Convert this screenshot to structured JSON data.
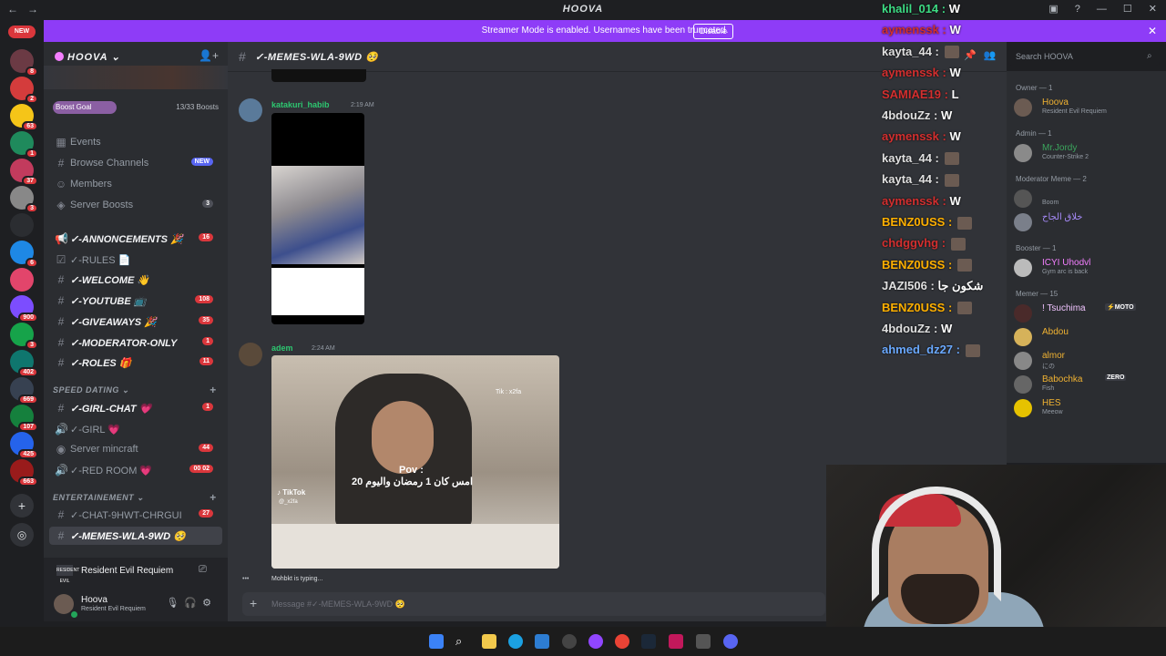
{
  "titlebar": {
    "app_title": "HOOVA",
    "back": "←",
    "forward": "→"
  },
  "banner": {
    "text": "Streamer Mode is enabled. Usernames have been truncated.",
    "disable_label": "Disable"
  },
  "rail": {
    "new_label": "NEW",
    "servers": [
      {
        "color": "#6b3a44",
        "badge": "8"
      },
      {
        "color": "#d43c3c",
        "badge": "2"
      },
      {
        "color": "#f5c518",
        "badge": "63"
      },
      {
        "color": "#1f8a5c",
        "badge": "1"
      },
      {
        "color": "#c23b5d",
        "badge": "37"
      },
      {
        "color": "#888888",
        "badge": "3"
      },
      {
        "color": "#2b2d31",
        "badge": ""
      },
      {
        "color": "#1e88e5",
        "badge": "6"
      },
      {
        "color": "#e2456b",
        "badge": ""
      },
      {
        "color": "#7c4dff",
        "badge": "900"
      },
      {
        "color": "#16a34a",
        "badge": "3"
      },
      {
        "color": "#0f766e",
        "badge": "402"
      },
      {
        "color": "#374151",
        "badge": "669"
      },
      {
        "color": "#15803d",
        "badge": "107"
      },
      {
        "color": "#2563eb",
        "badge": "425"
      },
      {
        "color": "#991b1b",
        "badge": "663"
      }
    ]
  },
  "sidebar": {
    "server_name": "HOOVA",
    "boost_goal": "Boost Goal",
    "boost_count": "13/33 Boosts",
    "top_items": [
      {
        "icon": "▦",
        "label": "Events",
        "badge": "",
        "badge_kind": ""
      },
      {
        "icon": "#",
        "label": "Browse Channels",
        "badge": "NEW",
        "badge_kind": "blue"
      },
      {
        "icon": "☺",
        "label": "Members",
        "badge": "",
        "badge_kind": ""
      },
      {
        "icon": "◈",
        "label": "Server Boosts",
        "badge": "3",
        "badge_kind": "gray"
      }
    ],
    "channels": [
      {
        "icon": "📢",
        "label": "✓-ANNONCEMENTS 🎉",
        "badge": "16",
        "bold": true
      },
      {
        "icon": "☑",
        "label": "✓-RULES 📄",
        "badge": "",
        "bold": false
      },
      {
        "icon": "#",
        "label": "✓-WELCOME 👋",
        "badge": "",
        "bold": true
      },
      {
        "icon": "#",
        "label": "✓-YOUTUBE 📺",
        "badge": "108",
        "bold": true
      },
      {
        "icon": "#",
        "label": "✓-GIVEAWAYS 🎉",
        "badge": "35",
        "bold": true
      },
      {
        "icon": "#",
        "label": "✓-MODERATOR-ONLY",
        "badge": "1",
        "bold": true
      },
      {
        "icon": "#",
        "label": "✓-ROLES 🎁",
        "badge": "11",
        "bold": true
      }
    ],
    "category1": "SPEED DATING ⌄",
    "speed_channels": [
      {
        "icon": "#",
        "label": "✓-GIRL-CHAT 💗",
        "badge": "1",
        "bold": true
      },
      {
        "icon": "🔊",
        "label": "✓-GIRL 💗",
        "badge": "",
        "bold": false
      },
      {
        "icon": "◉",
        "label": "Server mincraft",
        "badge": "44",
        "bold": false
      },
      {
        "icon": "🔊",
        "label": "✓-RED ROOM 💗",
        "badge": "00 02",
        "bold": false
      }
    ],
    "category2": "ENTERTAINEMENT ⌄",
    "ent_channels": [
      {
        "icon": "#",
        "label": "✓-CHAT-9HWT-CHRGUI",
        "badge": "27",
        "bold": false
      },
      {
        "icon": "#",
        "label": "✓-MEMES-WLA-9WD 🥺",
        "badge": "",
        "bold": true
      }
    ]
  },
  "activity": {
    "icon_text": "RESIDENT EVIL",
    "label": "Resident Evil Requiem"
  },
  "user": {
    "name": "Hoova",
    "status": "Resident Evil Requiem"
  },
  "chat": {
    "channel_title": "✓-MEMES-WLA-9WD 🥺",
    "messages": [
      {
        "author": "katakuri_habib",
        "time": "2:19 AM",
        "color": "#2dc770"
      },
      {
        "author": "adem",
        "time": "2:24 AM",
        "color": "#2dc770"
      }
    ],
    "video_watermark": "Tik : x2fa",
    "video_tiktok": "♪ TikTok",
    "video_handle": "@_x2fa",
    "video_pov": "Pov :",
    "video_caption": "امس كان 1 رمضان واليوم 20",
    "typing": "Mohbkt is typing...",
    "composer_placeholder": "Message #✓-MEMES-WLA-9WD 🥺"
  },
  "members": {
    "search_placeholder": "Search HOOVA",
    "groups": [
      {
        "title": "Owner — 1",
        "members": [
          {
            "name": "Hoova",
            "status": "Resident Evil Requiem",
            "color": "#f0b232",
            "av": "#6b5b52"
          }
        ]
      },
      {
        "title": "Admin — 1",
        "members": [
          {
            "name": "Mr.Jordy",
            "status": "Counter-Strike 2",
            "color": "#3ba55d",
            "av": "#8a8a8a"
          }
        ]
      },
      {
        "title": "Moderator Meme — 2",
        "members": [
          {
            "name": "",
            "status": "Boom",
            "color": "#dbdee1",
            "av": "#555555"
          },
          {
            "name": "خلاق الجاح",
            "status": "",
            "color": "#a78bfa",
            "av": "#7a7f8a"
          }
        ]
      },
      {
        "title": "Booster — 1",
        "members": [
          {
            "name": "ICYI Uhodvl",
            "status": "Gym arc is back",
            "color": "#f47fff",
            "av": "#bbbbbb"
          }
        ]
      },
      {
        "title": "Memer — 15",
        "members": [
          {
            "name": "! Tsuchima",
            "status": "",
            "color": "#f1c4ff",
            "av": "#4a2a2a",
            "tag": "⚡MOTO"
          },
          {
            "name": "Abdou",
            "status": "",
            "color": "#f0b232",
            "av": "#d6b25a"
          },
          {
            "name": "almor",
            "status": "にの",
            "color": "#f0b232",
            "av": "#888888"
          },
          {
            "name": "Babochka",
            "status": "Fish",
            "color": "#f0b232",
            "av": "#666666",
            "tag": "ZERO"
          },
          {
            "name": "HES",
            "status": "Meeow",
            "color": "#f0b232",
            "av": "#e6c200"
          }
        ]
      }
    ]
  },
  "overlay": [
    {
      "name": "khalil_014 :",
      "color": "#3ddc84",
      "msg": "W"
    },
    {
      "name": "aymenssk :",
      "color": "#d32f2f",
      "msg": "W"
    },
    {
      "name": "kayta_44 :",
      "color": "#e0e0e0",
      "msg": ""
    },
    {
      "name": "aymenssk :",
      "color": "#d32f2f",
      "msg": "W"
    },
    {
      "name": "SAMIAE19 :",
      "color": "#d32f2f",
      "msg": "L"
    },
    {
      "name": "4bdouZz :",
      "color": "#e0e0e0",
      "msg": "W"
    },
    {
      "name": "aymenssk :",
      "color": "#d32f2f",
      "msg": "W"
    },
    {
      "name": "kayta_44 :",
      "color": "#e0e0e0",
      "msg": ""
    },
    {
      "name": "kayta_44 :",
      "color": "#e0e0e0",
      "msg": ""
    },
    {
      "name": "aymenssk :",
      "color": "#d32f2f",
      "msg": "W"
    },
    {
      "name": "BENZ0USS :",
      "color": "#ffb000",
      "msg": ""
    },
    {
      "name": "chdggvhg :",
      "color": "#d32f2f",
      "msg": ""
    },
    {
      "name": "BENZ0USS :",
      "color": "#ffb000",
      "msg": ""
    },
    {
      "name": "JAZI506 :",
      "color": "#e0e0e0",
      "msg": "شكون جا"
    },
    {
      "name": "BENZ0USS :",
      "color": "#ffb000",
      "msg": ""
    },
    {
      "name": "4bdouZz :",
      "color": "#e0e0e0",
      "msg": "W"
    },
    {
      "name": "ahmed_dz27 :",
      "color": "#6aa9ff",
      "msg": ""
    }
  ]
}
